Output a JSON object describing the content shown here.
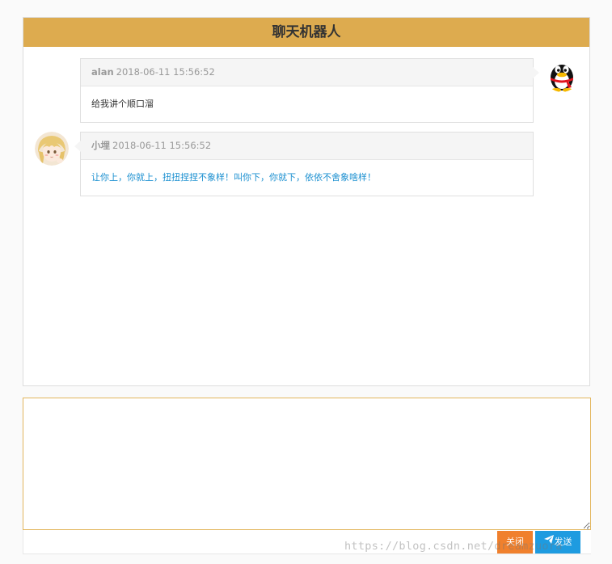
{
  "header": {
    "title": "聊天机器人"
  },
  "messages": [
    {
      "sender": "alan",
      "time": "2018-06-11 15:56:52",
      "text": "给我讲个顺口溜",
      "side": "right",
      "avatar_icon": "qq-penguin-icon"
    },
    {
      "sender": "小埋",
      "time": "2018-06-11 15:56:52",
      "text": "让你上，你就上，扭扭捏捏不象样！叫你下，你就下，依依不舍象啥样！",
      "side": "left",
      "avatar_icon": "anime-girl-avatar"
    }
  ],
  "input": {
    "value": "",
    "placeholder": ""
  },
  "buttons": {
    "close_label": "关闭",
    "send_label": "发送",
    "send_icon": "paper-plane-icon"
  },
  "watermark": "https://blog.csdn.net/dreamzuora",
  "colors": {
    "header_bg": "#ddab4f",
    "user_text": "#333333",
    "bot_text": "#1a8fd0",
    "close_btn": "#f0802d",
    "send_btn": "#1e9be0",
    "input_border": "#e2b55c"
  }
}
